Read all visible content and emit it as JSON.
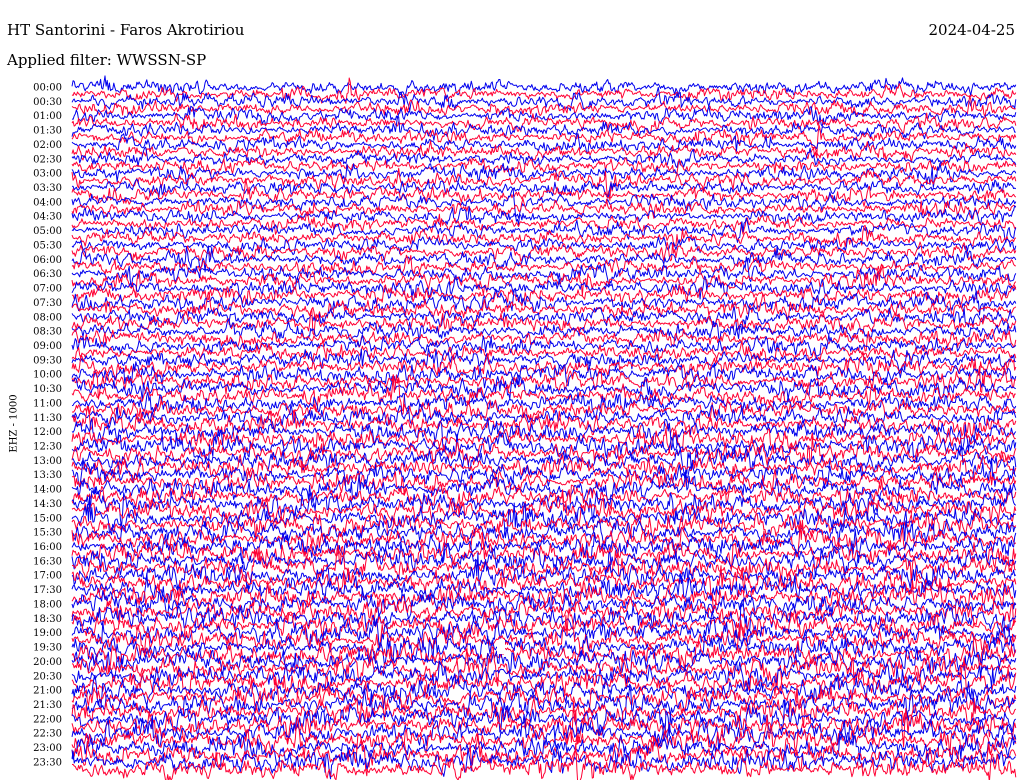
{
  "header": {
    "station": "HT Santorini - Faros Akrotiriou",
    "date": "2024-04-25",
    "filter_text": "Applied filter: WWSSN-SP"
  },
  "chart_data": {
    "type": "line",
    "title": "HT Santorini - Faros Akrotiriou",
    "subtitle": "Applied filter: WWSSN-SP",
    "ylabel": "EHZ - 1000",
    "xlabel": "",
    "date": "2024-04-25",
    "grid": false,
    "legend": "none",
    "row_interval_minutes": 15,
    "row_labels": [
      "00:00",
      "00:30",
      "01:00",
      "01:30",
      "02:00",
      "02:30",
      "03:00",
      "03:30",
      "04:00",
      "04:30",
      "05:00",
      "05:30",
      "06:00",
      "06:30",
      "07:00",
      "07:30",
      "08:00",
      "08:30",
      "09:00",
      "09:30",
      "10:00",
      "10:30",
      "11:00",
      "11:30",
      "12:00",
      "12:30",
      "13:00",
      "13:30",
      "14:00",
      "14:30",
      "15:00",
      "15:30",
      "16:00",
      "16:30",
      "17:00",
      "17:30",
      "18:00",
      "18:30",
      "19:00",
      "19:30",
      "20:00",
      "20:30",
      "21:00",
      "21:30",
      "22:00",
      "22:30",
      "23:00",
      "23:30"
    ],
    "trace_colors": [
      "#0000ee",
      "#ff0033"
    ],
    "noise_level": [
      0.5,
      0.5,
      0.5,
      0.5,
      0.5,
      0.5,
      0.5,
      0.5,
      0.5,
      0.5,
      0.5,
      0.5,
      0.52,
      0.52,
      0.54,
      0.54,
      0.52,
      0.52,
      0.5,
      0.5,
      0.52,
      0.52,
      0.52,
      0.52,
      0.56,
      0.56,
      0.6,
      0.6,
      0.68,
      0.7,
      0.72,
      0.72,
      0.66,
      0.66,
      0.66,
      0.66,
      0.68,
      0.68,
      0.68,
      0.7,
      0.74,
      0.74,
      0.76,
      0.76,
      0.8,
      0.8,
      0.82,
      0.82,
      0.86,
      0.88,
      0.9,
      0.9,
      0.9,
      0.9,
      0.9,
      0.9,
      0.92,
      0.92,
      0.94,
      0.94,
      0.96,
      0.96,
      0.96,
      0.96,
      0.96,
      0.96,
      0.96,
      0.96,
      0.98,
      0.98,
      1.0,
      1.0,
      1.0,
      1.0,
      1.0,
      1.0,
      1.0,
      1.0,
      1.0,
      1.0,
      1.0,
      1.0,
      1.0,
      1.0,
      1.0,
      1.0,
      1.0,
      1.0,
      1.0,
      1.0,
      1.0,
      1.0,
      1.0,
      1.0,
      1.0,
      1.0
    ]
  }
}
